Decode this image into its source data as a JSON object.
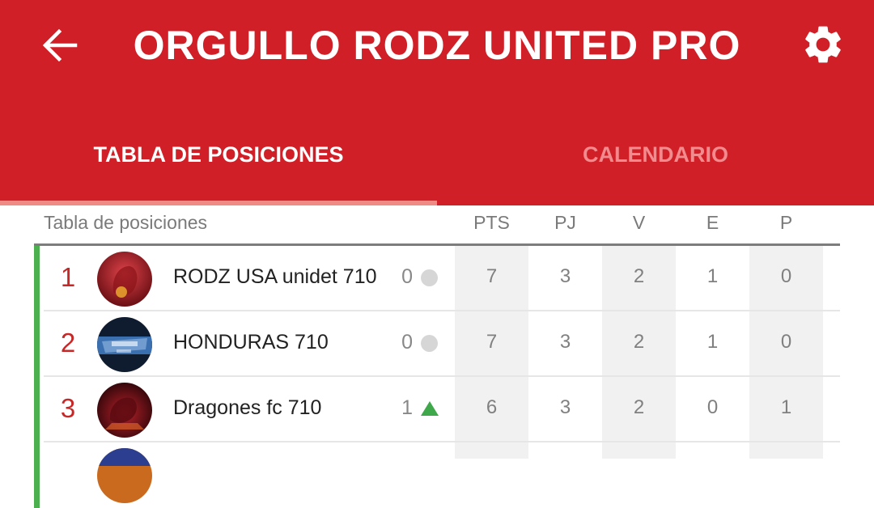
{
  "header": {
    "title": "ORGULLO RODZ UNITED PRO",
    "back_icon": "arrow-left-icon",
    "settings_icon": "gear-icon",
    "background_color": "#d01f27"
  },
  "tabs": [
    {
      "label": "TABLA DE POSICIONES",
      "active": true
    },
    {
      "label": "CALENDARIO",
      "active": false
    }
  ],
  "standings": {
    "title": "Tabla de posiciones",
    "columns": [
      "PTS",
      "PJ",
      "V",
      "E",
      "P"
    ],
    "rows": [
      {
        "position": "1",
        "team": "RODZ USA unidet 710",
        "change": "0",
        "trend": "same",
        "pts": "7",
        "pj": "3",
        "v": "2",
        "e": "1",
        "p": "0"
      },
      {
        "position": "2",
        "team": "HONDURAS 710",
        "change": "0",
        "trend": "same",
        "pts": "7",
        "pj": "3",
        "v": "2",
        "e": "1",
        "p": "0"
      },
      {
        "position": "3",
        "team": "Dragones fc 710",
        "change": "1",
        "trend": "up",
        "pts": "6",
        "pj": "3",
        "v": "2",
        "e": "0",
        "p": "1"
      }
    ]
  }
}
